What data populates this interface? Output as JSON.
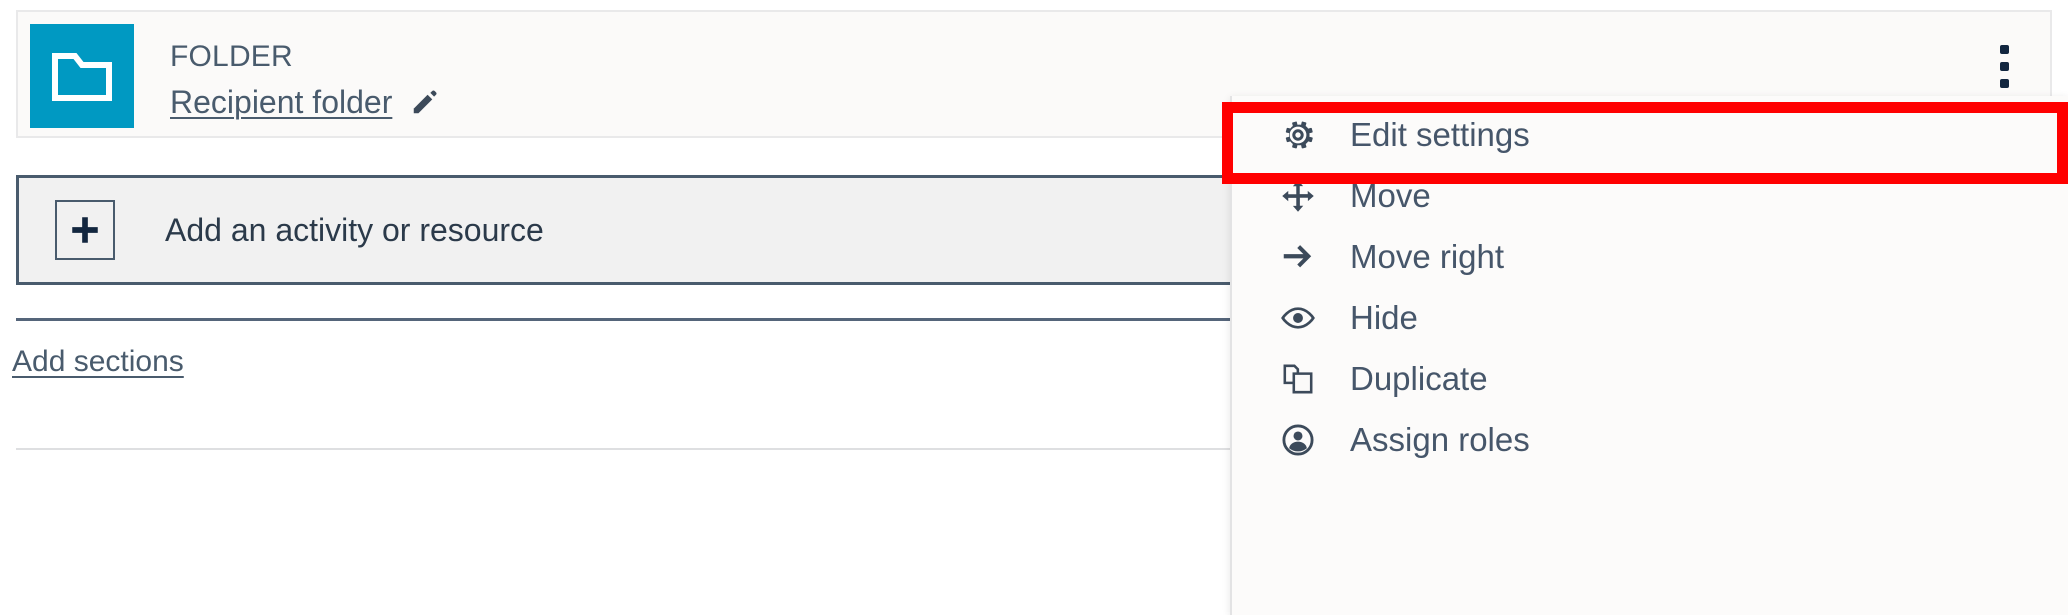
{
  "activity": {
    "type_label": "FOLDER",
    "name": "Recipient folder",
    "icon": "folder-icon",
    "icon_color": "#0099c2",
    "edit_icon": "pencil-icon",
    "menu_toggle_icon": "kebab-menu-icon"
  },
  "add_activity": {
    "label": "Add an activity or resource",
    "icon": "plus-icon"
  },
  "add_sections": {
    "label": "Add sections"
  },
  "dropdown": {
    "items": [
      {
        "label": "Edit settings",
        "icon": "gear-icon",
        "highlighted": true
      },
      {
        "label": "Move",
        "icon": "move-arrows-icon",
        "highlighted": false
      },
      {
        "label": "Move right",
        "icon": "arrow-right-icon",
        "highlighted": false
      },
      {
        "label": "Hide",
        "icon": "eye-icon",
        "highlighted": false
      },
      {
        "label": "Duplicate",
        "icon": "duplicate-icon",
        "highlighted": false
      },
      {
        "label": "Assign roles",
        "icon": "user-circle-icon",
        "highlighted": false
      }
    ]
  },
  "annotation": {
    "highlight_color": "#ff0000",
    "highlight_target": "Edit settings"
  },
  "colors": {
    "text": "#495b6d",
    "panel_bg": "#fbfaf9",
    "bar_bg": "#f1f1f1",
    "accent": "#0099c2"
  }
}
